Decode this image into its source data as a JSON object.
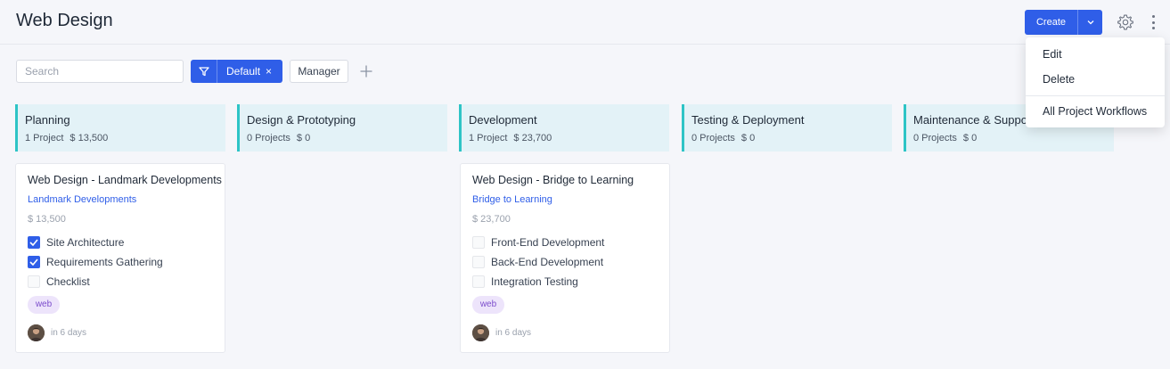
{
  "header": {
    "title": "Web Design",
    "create_label": "Create"
  },
  "toolbar": {
    "search_placeholder": "Search",
    "filter_label": "Default",
    "filter_remove": "×",
    "manager_label": "Manager"
  },
  "menu": {
    "items": [
      "Edit",
      "Delete",
      "All Project Workflows"
    ]
  },
  "columns": [
    {
      "name": "Planning",
      "count": "1 Project",
      "amount": "$ 13,500"
    },
    {
      "name": "Design & Prototyping",
      "count": "0 Projects",
      "amount": "$ 0"
    },
    {
      "name": "Development",
      "count": "1 Project",
      "amount": "$ 23,700"
    },
    {
      "name": "Testing & Deployment",
      "count": "0 Projects",
      "amount": "$ 0"
    },
    {
      "name": "Maintenance & Support",
      "count": "0 Projects",
      "amount": "$ 0"
    }
  ],
  "cards": [
    {
      "title": "Web Design - Landmark Developments",
      "company": "Landmark Developments",
      "amount": "$ 13,500",
      "tasks": [
        {
          "label": "Site Architecture",
          "checked": true
        },
        {
          "label": "Requirements Gathering",
          "checked": true
        },
        {
          "label": "Checklist",
          "checked": false
        }
      ],
      "tag": "web",
      "due": "in 6 days"
    },
    {
      "title": "Web Design - Bridge to Learning",
      "company": "Bridge to Learning",
      "amount": "$ 23,700",
      "tasks": [
        {
          "label": "Front-End Development",
          "checked": false
        },
        {
          "label": "Back-End Development",
          "checked": false
        },
        {
          "label": "Integration Testing",
          "checked": false
        }
      ],
      "tag": "web",
      "due": "in 6 days"
    }
  ],
  "colors": {
    "primary": "#2f5ee8",
    "column_header_bg": "#e3f2f7",
    "column_accent": "#2ec4c6",
    "tag_bg": "#ede4fb",
    "tag_text": "#7c4dcc"
  },
  "icons": {
    "create_dropdown": "chevron-down-icon",
    "settings": "gear-icon",
    "more": "kebab-icon",
    "filter": "filter-icon",
    "add_filter": "plus-icon",
    "task_checked": "checkbox-checked-icon",
    "task_unchecked": "checkbox-unchecked-icon"
  }
}
